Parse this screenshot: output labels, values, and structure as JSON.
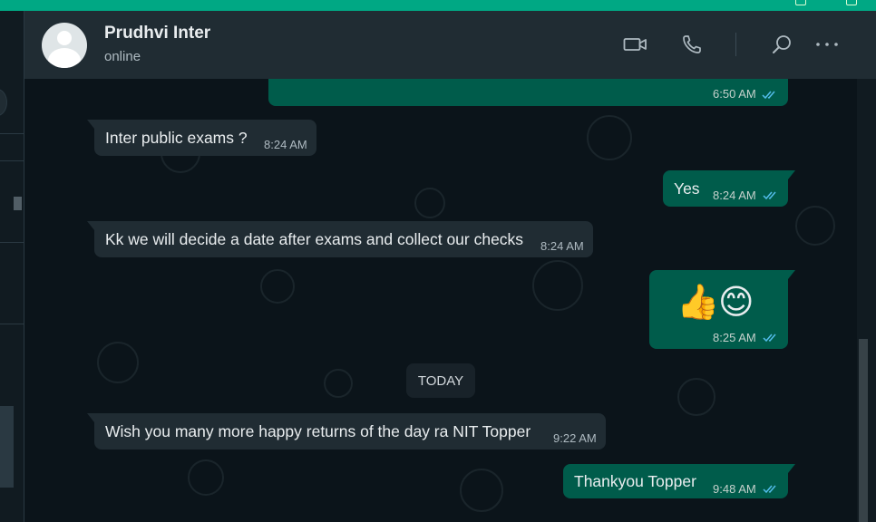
{
  "header": {
    "contact_name": "Prudhvi Inter",
    "contact_status": "online",
    "icons": [
      "video-call-icon",
      "voice-call-icon",
      "search-icon",
      "menu-icon"
    ]
  },
  "messages": [
    {
      "direction": "outgoing",
      "text": "",
      "time": "6:50 AM",
      "status": "read"
    },
    {
      "direction": "incoming",
      "text": "Inter public exams ?",
      "time": "8:24 AM"
    },
    {
      "direction": "outgoing",
      "text": "Yes",
      "time": "8:24 AM",
      "status": "read"
    },
    {
      "direction": "incoming",
      "text": "Kk we will decide a date after exams and collect our checks",
      "time": "8:24 AM"
    },
    {
      "direction": "outgoing",
      "emoji": [
        "👍",
        "😊"
      ],
      "time": "8:25 AM",
      "status": "read"
    },
    {
      "direction": "incoming",
      "text": "Wish you many more happy returns of the day ra NIT Topper",
      "time": "9:22 AM"
    },
    {
      "direction": "outgoing",
      "text": "Thankyou Topper",
      "time": "9:48 AM",
      "status": "read"
    }
  ],
  "day_divider": "TODAY",
  "colors": {
    "accent": "#00a884",
    "outgoing_bubble": "#005c4b",
    "incoming_bubble": "#202c33",
    "read_tick": "#53bdeb",
    "chat_background": "#0b141a"
  }
}
